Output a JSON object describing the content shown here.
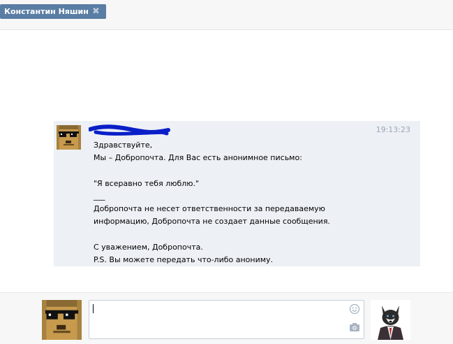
{
  "chat_tab": {
    "name": "Константин Няшин",
    "close_icon": "close-x-icon"
  },
  "message": {
    "time": "19:13:23",
    "lines": [
      "Здравствуйте,",
      "Мы – Добропочта. Для Вас есть анонимное письмо:",
      "",
      "\"Я всеравно тебя люблю.\"",
      "___",
      "Добропочта не несет ответственности за передаваемую",
      "информацию, Добропочта не создает данные сообщения.",
      "",
      "С уважением, Добропочта.",
      "P.S. Вы можете передать что-либо анониму."
    ]
  },
  "composer": {
    "value": "",
    "placeholder": "",
    "icons": [
      "smile-icon",
      "camera-icon"
    ]
  },
  "colors": {
    "tab_bg": "#597da3",
    "message_bg": "#edf0f5",
    "bar_bg": "#f7f7f7",
    "scribble": "#0a1fc8",
    "time": "#9aa6b6"
  }
}
